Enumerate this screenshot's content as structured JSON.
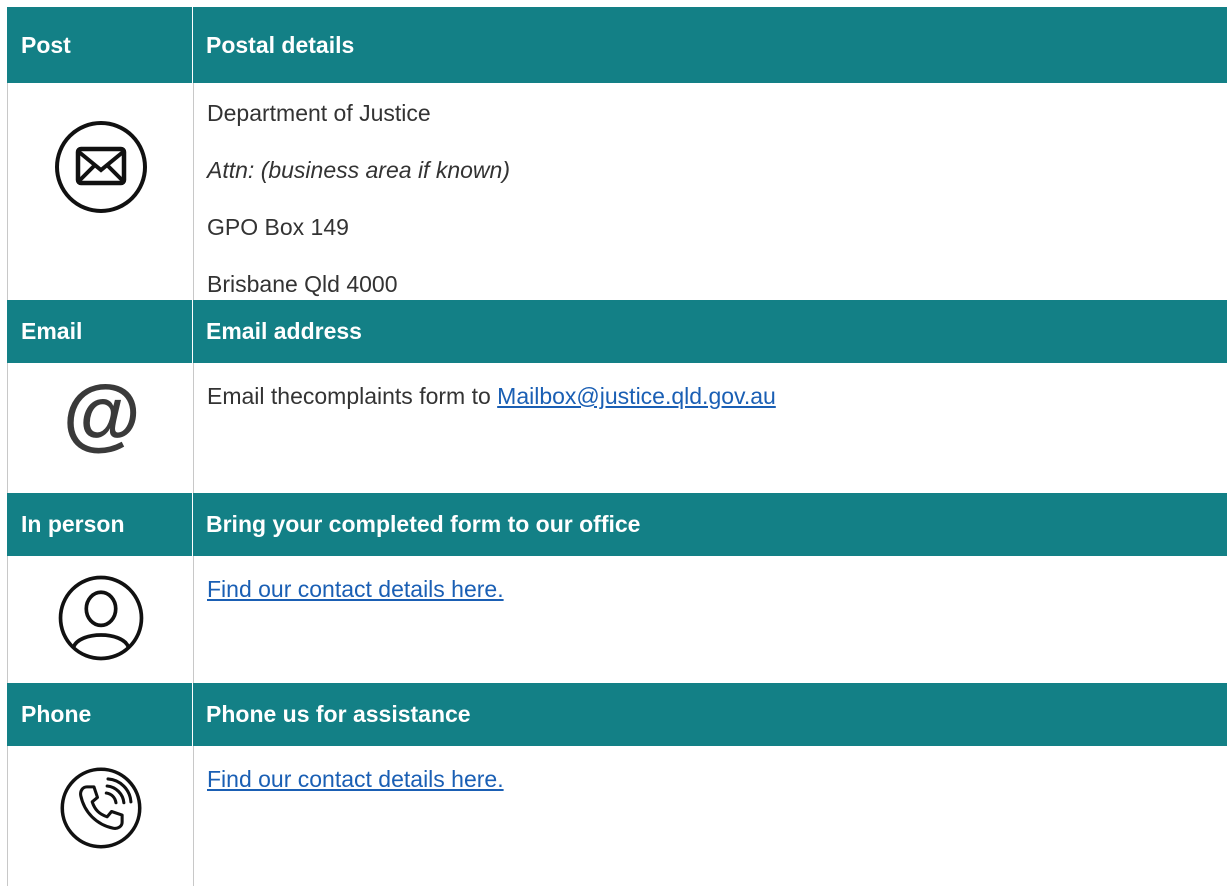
{
  "post": {
    "header_label": "Post",
    "header_title": "Postal details",
    "icon": "envelope-icon",
    "lines": [
      "Department of Justice",
      "Attn: (business area if known)",
      "GPO Box 149",
      "Brisbane Qld 4000"
    ]
  },
  "email": {
    "header_label": "Email",
    "header_title": "Email address",
    "icon": "at-sign-icon",
    "icon_glyph": "@",
    "text": "Email thecomplaints form to ",
    "link": "Mailbox@justice.qld.gov.au"
  },
  "in_person": {
    "header_label": "In person",
    "header_title": "Bring your completed form to our office",
    "icon": "person-icon",
    "link": "Find our contact details here."
  },
  "phone": {
    "header_label": "Phone",
    "header_title": "Phone us for assistance",
    "icon": "phone-icon",
    "link": "Find our contact details here."
  },
  "colors": {
    "header_bg": "#138086",
    "link": "#1a5fb4",
    "text": "#333333"
  }
}
